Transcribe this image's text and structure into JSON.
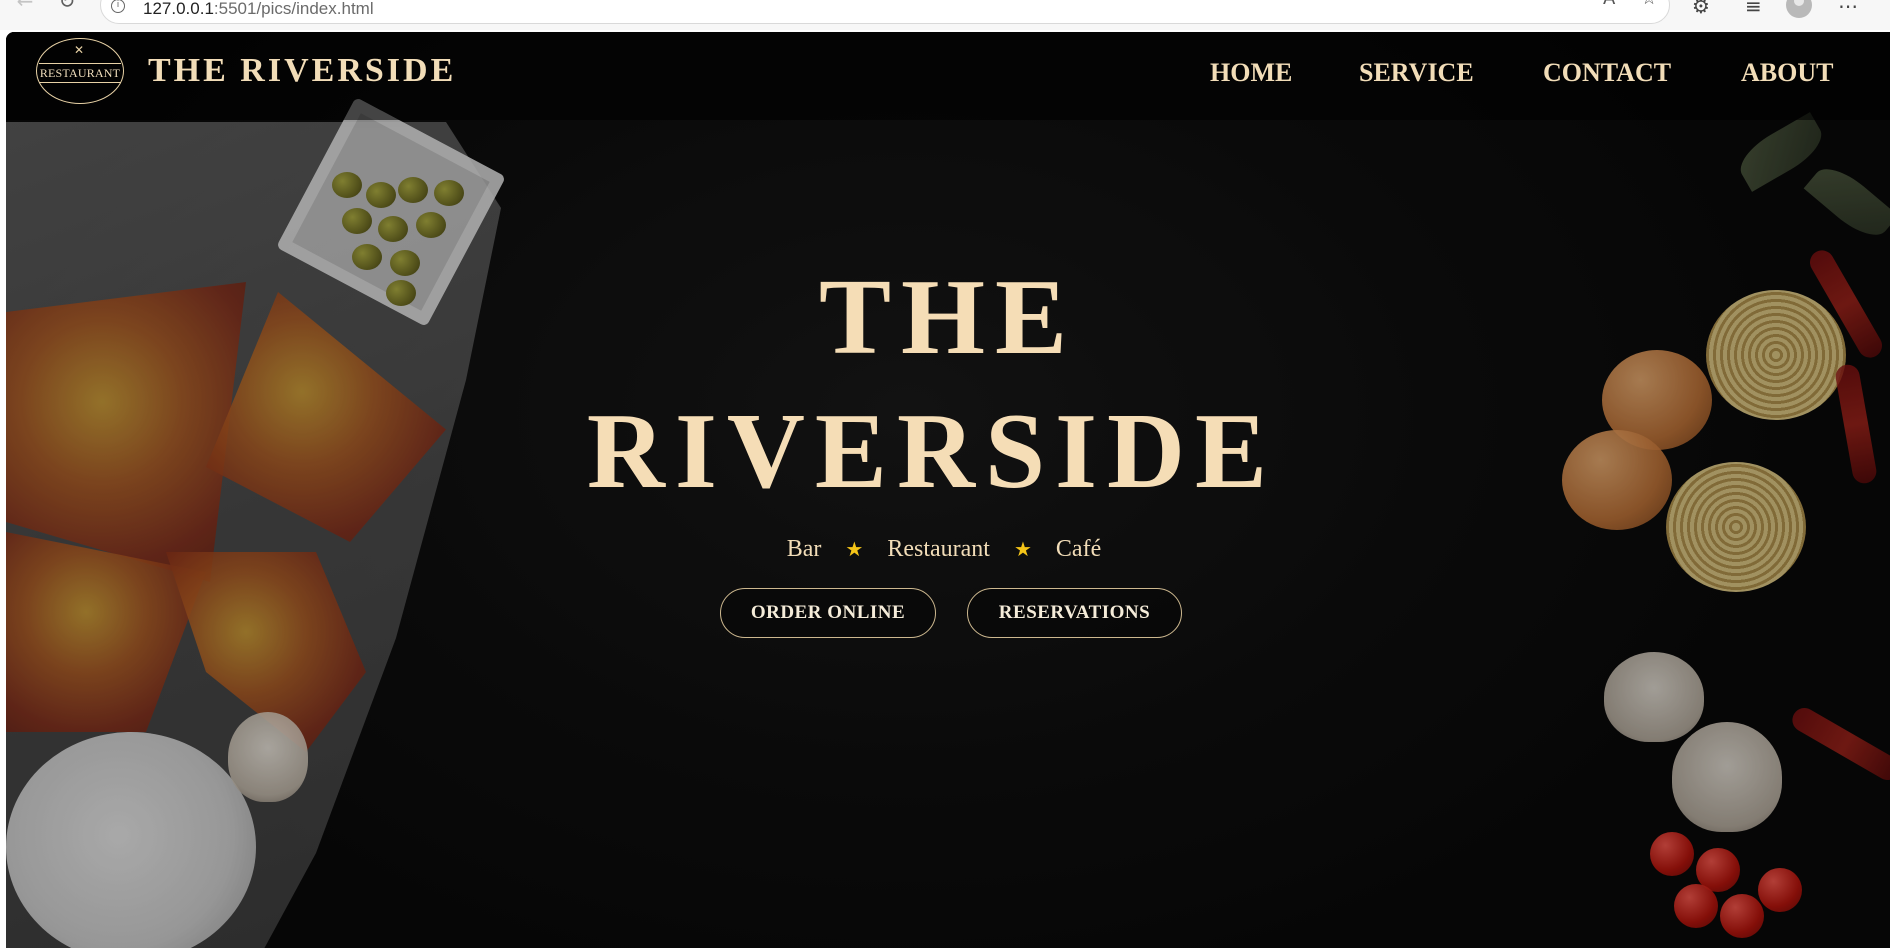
{
  "browser": {
    "url_host": "127.0.0.1",
    "url_rest": ":5501/pics/index.html"
  },
  "header": {
    "logo_text": "RESTAURANT",
    "brand": "THE RIVERSIDE",
    "nav": [
      {
        "label": "HOME"
      },
      {
        "label": "SERVICE"
      },
      {
        "label": "CONTACT"
      },
      {
        "label": "ABOUT"
      }
    ]
  },
  "hero": {
    "title_line1": "THE",
    "title_line2": "RIVERSIDE",
    "tagline": [
      "Bar",
      "Restaurant",
      "Café"
    ],
    "buttons": {
      "order": "ORDER ONLINE",
      "reservations": "RESERVATIONS"
    }
  },
  "colors": {
    "accent_gold": "#f2ddb8",
    "star_yellow": "#f5c518",
    "background": "#0b0b0b"
  }
}
